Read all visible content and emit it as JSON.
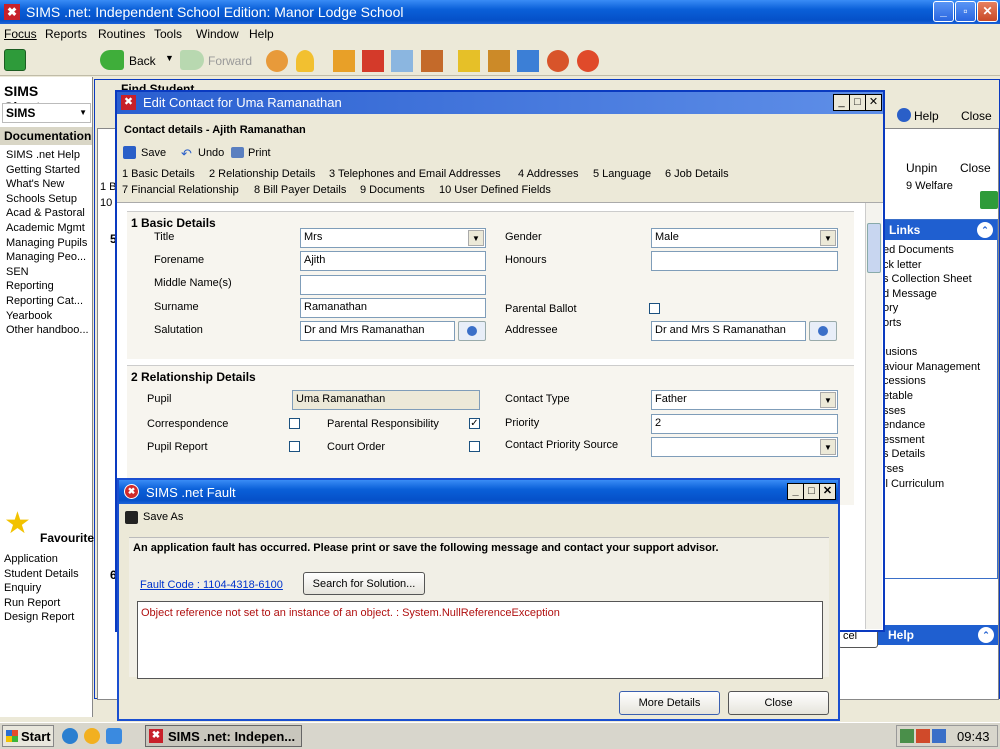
{
  "app": {
    "title": "SIMS .net: Independent School Edition: Manor Lodge School"
  },
  "menu": [
    "Focus",
    "Reports",
    "Routines",
    "Tools",
    "Window",
    "Help"
  ],
  "toolbar": {
    "back": "Back",
    "forward": "Forward"
  },
  "sidebar": {
    "title": "SIMS Shortcu",
    "dropdown": "SIMS",
    "section": "Documentation",
    "items": [
      "SIMS .net Help",
      "Getting Started",
      "What's New",
      "Schools Setup",
      "Acad & Pastoral",
      "Academic Mgmt",
      "Managing Pupils",
      "Managing Peo...",
      "SEN",
      "Reporting",
      "Reporting Cat...",
      "Yearbook",
      "Other handboo..."
    ],
    "fav_title": "Favourite",
    "fav_items": [
      "Application",
      "Student Details",
      "Enquiry",
      "Run Report",
      "Design Report"
    ]
  },
  "bg": {
    "find_student": "Find Student",
    "help": "Help",
    "close": "Close",
    "unpin": "Unpin",
    "close2": "Close",
    "welfare": "9 Welfare",
    "links_title": "Links",
    "links": [
      "ed Documents",
      "ck letter",
      "s Collection Sheet",
      "d Message",
      "ory",
      "orts",
      "",
      "lusions",
      "aviour Management",
      "cessions",
      "etable",
      "sses",
      "endance",
      "essment",
      "s Details",
      "rses",
      "il Curriculum"
    ],
    "help_title": "Help",
    "row1": "1 B",
    "row2": "10",
    "num5": "5",
    "num6": "6",
    "cancel": "cel"
  },
  "contact": {
    "title": "Edit Contact for Uma Ramanathan",
    "subtitle": "Contact details - Ajith Ramanathan",
    "save": "Save",
    "undo": "Undo",
    "print": "Print",
    "tabs1": [
      "1 Basic Details",
      "2 Relationship Details",
      "3 Telephones and Email Addresses",
      "4 Addresses",
      "5 Language",
      "6 Job Details"
    ],
    "tabs2": [
      "7 Financial Relationship",
      "8 Bill Payer Details",
      "9 Documents",
      "10 User Defined Fields"
    ],
    "basic": {
      "heading": "1 Basic Details",
      "title_lbl": "Title",
      "title_val": "Mrs",
      "forename_lbl": "Forename",
      "forename_val": "Ajith",
      "middle_lbl": "Middle Name(s)",
      "middle_val": "",
      "surname_lbl": "Surname",
      "surname_val": "Ramanathan",
      "salutation_lbl": "Salutation",
      "salutation_val": "Dr and Mrs Ramanathan",
      "gender_lbl": "Gender",
      "gender_val": "Male",
      "honours_lbl": "Honours",
      "honours_val": "",
      "ballot_lbl": "Parental Ballot",
      "addressee_lbl": "Addressee",
      "addressee_val": "Dr and Mrs S Ramanathan"
    },
    "rel": {
      "heading": "2 Relationship Details",
      "pupil_lbl": "Pupil",
      "pupil_val": "Uma Ramanathan",
      "corr_lbl": "Correspondence",
      "pr_lbl": "Parental Responsibility",
      "report_lbl": "Pupil Report",
      "court_lbl": "Court Order",
      "ctype_lbl": "Contact Type",
      "ctype_val": "Father",
      "priority_lbl": "Priority",
      "priority_val": "2",
      "cps_lbl": "Contact Priority Source",
      "cps_val": ""
    }
  },
  "fault": {
    "title": "SIMS .net Fault",
    "save_as": "Save As",
    "message": "An application fault has occurred. Please print or save the following message and contact your support advisor.",
    "code": "Fault Code : 1104-4318-6100",
    "search": "Search for Solution...",
    "detail": "Object reference not set to an instance of an object. : System.NullReferenceException",
    "more": "More Details",
    "close": "Close"
  },
  "taskbar": {
    "start": "Start",
    "task": "SIMS .net: Indepen...",
    "time": "09:43"
  }
}
